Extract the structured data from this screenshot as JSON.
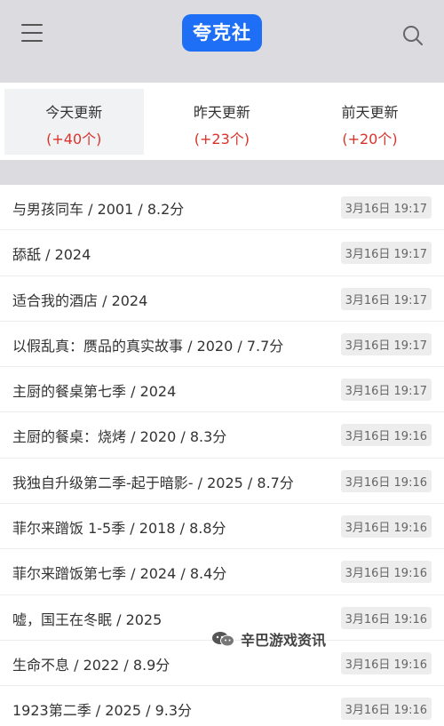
{
  "header": {
    "logo_text": "夸克社",
    "menu_icon": "hamburger-menu-icon",
    "search_icon": "search-icon"
  },
  "tabs": [
    {
      "title": "今天更新",
      "count": "(+40个)",
      "active": true
    },
    {
      "title": "昨天更新",
      "count": "(+23个)",
      "active": false
    },
    {
      "title": "前天更新",
      "count": "(+20个)",
      "active": false
    }
  ],
  "list": [
    {
      "title": "与男孩同车 / 2001 / 8.2分",
      "time": "3月16日 19:17"
    },
    {
      "title": "舔舐 / 2024",
      "time": "3月16日 19:17"
    },
    {
      "title": "适合我的酒店 / 2024",
      "time": "3月16日 19:17"
    },
    {
      "title": "以假乱真：赝品的真实故事 / 2020 / 7.7分",
      "time": "3月16日 19:17"
    },
    {
      "title": "主厨的餐桌第七季 / 2024",
      "time": "3月16日 19:17"
    },
    {
      "title": "主厨的餐桌：烧烤 / 2020 / 8.3分",
      "time": "3月16日 19:16"
    },
    {
      "title": "我独自升级第二季-起于暗影- / 2025 / 8.7分",
      "time": "3月16日 19:16"
    },
    {
      "title": "菲尔来蹭饭 1-5季 / 2018 / 8.8分",
      "time": "3月16日 19:16"
    },
    {
      "title": "菲尔来蹭饭第七季 / 2024 / 8.4分",
      "time": "3月16日 19:16"
    },
    {
      "title": "嘘，国王在冬眠 / 2025",
      "time": "3月16日 19:16"
    },
    {
      "title": "生命不息 / 2022 / 8.9分",
      "time": "3月16日 19:16"
    },
    {
      "title": "1923第二季 / 2025 / 9.3分",
      "time": "3月16日 19:16"
    }
  ],
  "watermark": {
    "text": "辛巴游戏资讯",
    "icon": "wechat-icon"
  },
  "colors": {
    "header_bg": "#dcdce0",
    "logo_bg": "#1e6ff5",
    "count_red": "#d9322b",
    "time_badge_bg": "#ededed"
  }
}
